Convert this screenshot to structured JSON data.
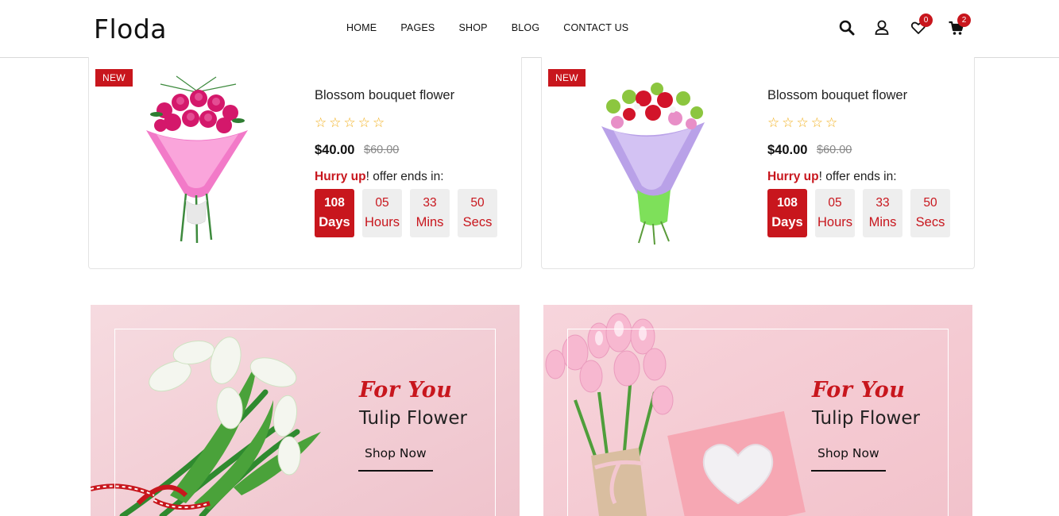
{
  "header": {
    "logo": "Floda",
    "nav": [
      "HOME",
      "PAGES",
      "SHOP",
      "BLOG",
      "CONTACT US"
    ],
    "icons": [
      "search-icon",
      "user-icon",
      "heart-icon",
      "cart-icon"
    ],
    "wishlist_count": "0",
    "cart_count": "2"
  },
  "deals": [
    {
      "badge": "NEW",
      "title": "Blossom bouquet flower",
      "rating": 0,
      "stars": [
        "☆",
        "☆",
        "☆",
        "☆",
        "☆"
      ],
      "price": "$40.00",
      "old_price": "$60.00",
      "hurry": "Hurry up",
      "offer_text": "! offer ends in:",
      "timer": [
        {
          "num": "108",
          "label": "Days"
        },
        {
          "num": "05",
          "label": "Hours"
        },
        {
          "num": "33",
          "label": "Mins"
        },
        {
          "num": "50",
          "label": "Secs"
        }
      ]
    },
    {
      "badge": "NEW",
      "title": "Blossom bouquet flower",
      "rating": 0,
      "stars": [
        "☆",
        "☆",
        "☆",
        "☆",
        "☆"
      ],
      "price": "$40.00",
      "old_price": "$60.00",
      "hurry": "Hurry up",
      "offer_text": "! offer ends in:",
      "timer": [
        {
          "num": "108",
          "label": "Days"
        },
        {
          "num": "05",
          "label": "Hours"
        },
        {
          "num": "33",
          "label": "Mins"
        },
        {
          "num": "50",
          "label": "Secs"
        }
      ]
    }
  ],
  "banners": [
    {
      "script": "For You",
      "title": "Tulip Flower",
      "button": "Shop Now"
    },
    {
      "script": "For You",
      "title": "Tulip Flower",
      "button": "Shop Now"
    }
  ],
  "colors": {
    "accent": "#c8161d",
    "star": "#f2b01e",
    "banner_bg": "#f3cfd6",
    "timer_bg": "#eeeeee"
  }
}
